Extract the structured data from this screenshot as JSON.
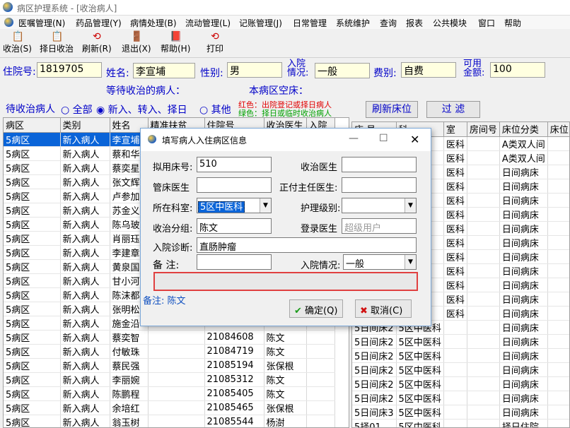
{
  "window": {
    "title": "病区护理系统 - [收治病人]"
  },
  "menu": [
    "医嘱管理(N)",
    "药品管理(Y)",
    "病情处理(B)",
    "流动管理(L)",
    "记账管理(J)",
    "日常管理",
    "系统维护",
    "查询",
    "报表",
    "公共模块",
    "窗口",
    "帮助"
  ],
  "toolbar": {
    "receive": "收治(S)",
    "select_day": "择日收治",
    "refresh": "刷新(R)",
    "exit": "退出(X)",
    "help": "帮助(H)",
    "print": "打印"
  },
  "patient": {
    "admission_no_label": "住院号:",
    "admission_no": "1819705",
    "name_label": "姓名:",
    "name": "李宣埔",
    "sex_label": "性别:",
    "sex": "男",
    "condition_label": "入院\n情况:",
    "condition": "一般",
    "fee_label": "费别:",
    "fee": "自费",
    "available_label": "可用\n金额:",
    "available": "100",
    "waiting_label": "等待收治的病人：",
    "empty_beds_label": "本病区空床："
  },
  "filter": {
    "prefix": "待收治病人",
    "all": "全部",
    "new": "新入、转入、择日",
    "other": "其他",
    "legend_red": "红色：出院登记或择日病人",
    "legend_green": "绿色：择日或临时收治病人",
    "refresh_beds": "刷新床位",
    "filter_btn": "过  滤"
  },
  "left_table": {
    "headers": [
      "病区",
      "类别",
      "姓名",
      "精准扶贫",
      "住院号",
      "收治医生",
      "入院"
    ],
    "rows": [
      [
        "5病区",
        "新入病人",
        "李宣埔",
        "",
        "",
        "",
        ""
      ],
      [
        "5病区",
        "新入病人",
        "蔡和华",
        "",
        "",
        "",
        ""
      ],
      [
        "5病区",
        "新入病人",
        "蔡奕星",
        "",
        "",
        "",
        ""
      ],
      [
        "5病区",
        "新入病人",
        "张文辉",
        "",
        "",
        "",
        ""
      ],
      [
        "5病区",
        "新入病人",
        "卢参加",
        "",
        "",
        "",
        ""
      ],
      [
        "5病区",
        "新入病人",
        "苏金义",
        "",
        "",
        "",
        ""
      ],
      [
        "5病区",
        "新入病人",
        "陈乌玻",
        "",
        "",
        "",
        ""
      ],
      [
        "5病区",
        "新入病人",
        "肖丽珏",
        "",
        "",
        "",
        ""
      ],
      [
        "5病区",
        "新入病人",
        "李建章",
        "",
        "",
        "",
        ""
      ],
      [
        "5病区",
        "新入病人",
        "黄泉国",
        "",
        "",
        "",
        ""
      ],
      [
        "5病区",
        "新入病人",
        "甘小河",
        "",
        "",
        "",
        ""
      ],
      [
        "5病区",
        "新入病人",
        "陈沫都",
        "",
        "",
        "",
        ""
      ],
      [
        "5病区",
        "新入病人",
        "张明松",
        "",
        "",
        "",
        ""
      ],
      [
        "5病区",
        "新入病人",
        "施金沿",
        "",
        "",
        "",
        ""
      ],
      [
        "5病区",
        "新入病人",
        "蔡奕智",
        "",
        "21084608",
        "陈文",
        ""
      ],
      [
        "5病区",
        "新入病人",
        "付敏珠",
        "",
        "21084719",
        "陈文",
        ""
      ],
      [
        "5病区",
        "新入病人",
        "蔡民强",
        "",
        "21085194",
        "张保根",
        ""
      ],
      [
        "5病区",
        "新入病人",
        "李丽婉",
        "",
        "21085312",
        "陈文",
        ""
      ],
      [
        "5病区",
        "新入病人",
        "陈鹏程",
        "",
        "21085405",
        "陈文",
        ""
      ],
      [
        "5病区",
        "新入病人",
        "余培红",
        "",
        "21085465",
        "张保根",
        ""
      ],
      [
        "5病区",
        "新入病人",
        "翁玉树",
        "",
        "21085544",
        "杨澍",
        ""
      ]
    ]
  },
  "right_table": {
    "headers": [
      "床  号",
      "科",
      "室",
      "房间号",
      "床位分类",
      "床位"
    ],
    "rows": [
      [
        "",
        "",
        "医科",
        "",
        "A类双人间",
        ""
      ],
      [
        "",
        "",
        "医科",
        "",
        "A类双人间",
        ""
      ],
      [
        "",
        "",
        "医科",
        "",
        "日间病床",
        ""
      ],
      [
        "",
        "",
        "医科",
        "",
        "日间病床",
        ""
      ],
      [
        "",
        "",
        "医科",
        "",
        "日间病床",
        ""
      ],
      [
        "",
        "",
        "医科",
        "",
        "日间病床",
        ""
      ],
      [
        "",
        "",
        "医科",
        "",
        "日间病床",
        ""
      ],
      [
        "",
        "",
        "医科",
        "",
        "日间病床",
        ""
      ],
      [
        "",
        "",
        "医科",
        "",
        "日间病床",
        ""
      ],
      [
        "",
        "",
        "医科",
        "",
        "日间病床",
        ""
      ],
      [
        "",
        "",
        "医科",
        "",
        "日间病床",
        ""
      ],
      [
        "",
        "",
        "医科",
        "",
        "日间病床",
        ""
      ],
      [
        "",
        "",
        "医科",
        "",
        "日间病床",
        ""
      ],
      [
        "5日间床2",
        "5区中医科",
        "",
        "",
        "日间病床",
        ""
      ],
      [
        "5日间床2",
        "5区中医科",
        "",
        "",
        "日间病床",
        ""
      ],
      [
        "5日间床2",
        "5区中医科",
        "",
        "",
        "日间病床",
        ""
      ],
      [
        "5日间床2",
        "5区中医科",
        "",
        "",
        "日间病床",
        ""
      ],
      [
        "5日间床2",
        "5区中医科",
        "",
        "",
        "日间病床",
        ""
      ],
      [
        "5日间床2",
        "5区中医科",
        "",
        "",
        "日间病床",
        ""
      ],
      [
        "5日间床3",
        "5区中医科",
        "",
        "",
        "日间病床",
        ""
      ],
      [
        "5择01",
        "5区中医科",
        "",
        "",
        "择日住院",
        ""
      ]
    ]
  },
  "dialog": {
    "title": "填写病人入住病区信息",
    "bed_label": "拟用床号:",
    "bed": "510",
    "receive_doctor_label": "收治医生",
    "receive_doctor": "",
    "bed_doctor_label": "管床医生",
    "bed_doctor": "",
    "chief_label": "正付主任医生:",
    "chief": "",
    "dept_label": "所在科室:",
    "dept": "5区中医科",
    "nursing_label": "护理级别:",
    "nursing": "",
    "group_label": "收治分组:",
    "group": "陈文",
    "login_doctor_label": "登录医生",
    "login_doctor_placeholder": "超级用户",
    "diagnosis_label": "入院诊断:",
    "diagnosis": "直肠肿瘤",
    "remark_label": "备    注:",
    "remark": "",
    "condition_label": "入院情况:",
    "condition": "一般",
    "note": "备注: 陈文",
    "ok": "确定(Q)",
    "cancel": "取消(C)"
  }
}
